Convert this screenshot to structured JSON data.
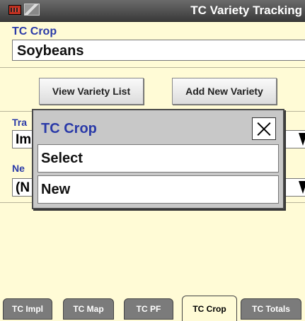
{
  "header": {
    "title": "TC Variety Tracking",
    "icons": [
      "implement-status-icon",
      "map-icon"
    ]
  },
  "crop": {
    "label": "TC Crop",
    "value": "Soybeans"
  },
  "actions": {
    "view_list": "View Variety List",
    "add_new": "Add New Variety"
  },
  "background_fields": [
    {
      "label": "Tra",
      "value": "Im"
    },
    {
      "label": "Ne",
      "value": "(N"
    }
  ],
  "popup": {
    "title": "TC Crop",
    "options": [
      "Select",
      "New"
    ]
  },
  "tabs": [
    {
      "label": "TC Impl",
      "active": false
    },
    {
      "label": "TC Map",
      "active": false
    },
    {
      "label": "TC PF",
      "active": false
    },
    {
      "label": "TC Crop",
      "active": true
    },
    {
      "label": "TC Totals",
      "active": false
    }
  ]
}
